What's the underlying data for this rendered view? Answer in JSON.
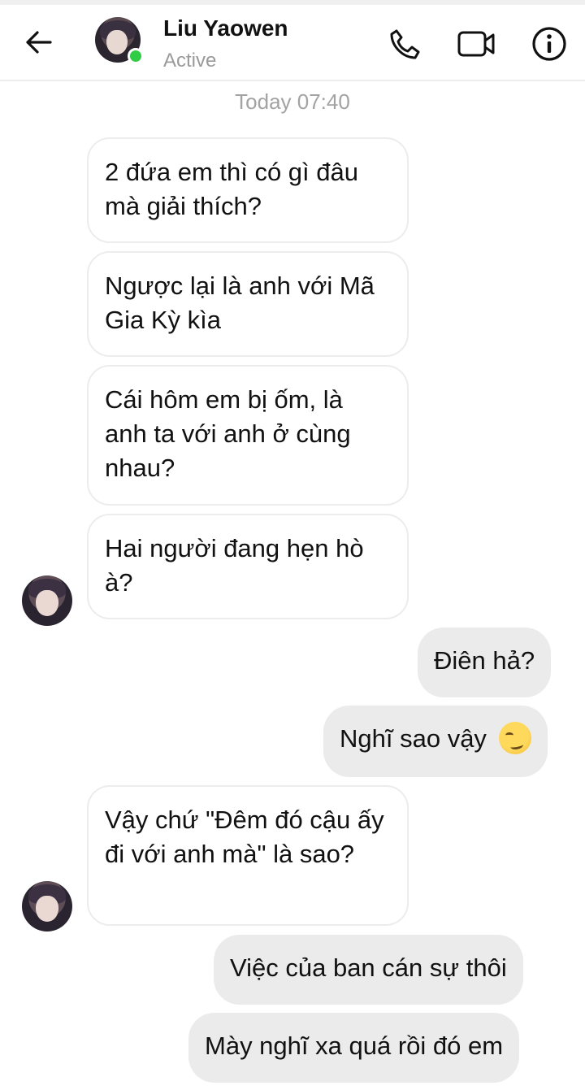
{
  "header": {
    "contact_name": "Liu Yaowen",
    "status": "Active",
    "icons": [
      "back-arrow-icon",
      "phone-icon",
      "video-camera-icon",
      "info-icon"
    ],
    "active_color": "#31cc46"
  },
  "timestamp": "Today 07:40",
  "messages": [
    {
      "side": "incoming",
      "text": "2 đứa em thì có gì đâu mà giải thích?"
    },
    {
      "side": "incoming",
      "text": "Ngược lại là anh với Mã Gia Kỳ kìa"
    },
    {
      "side": "incoming",
      "text": "Cái hôm em bị ốm, là anh ta với anh ở cùng nhau?"
    },
    {
      "side": "incoming",
      "text": "Hai người đang hẹn hò à?"
    },
    {
      "side": "outgoing",
      "text": "Điên hả?"
    },
    {
      "side": "outgoing",
      "text": "Nghĩ sao vậy",
      "emoji": "smirking-face"
    },
    {
      "side": "incoming",
      "text": "Vậy chứ \"Đêm đó cậu ấy đi với anh mà\" là sao?"
    },
    {
      "side": "outgoing",
      "text": "Việc của ban cán sự thôi"
    },
    {
      "side": "outgoing",
      "text": "Mày nghĩ xa quá rồi đó em"
    }
  ],
  "colors": {
    "outgoing_bubble": "#ebebeb",
    "incoming_border": "#ececec",
    "timestamp_text": "#a3a3a3"
  }
}
